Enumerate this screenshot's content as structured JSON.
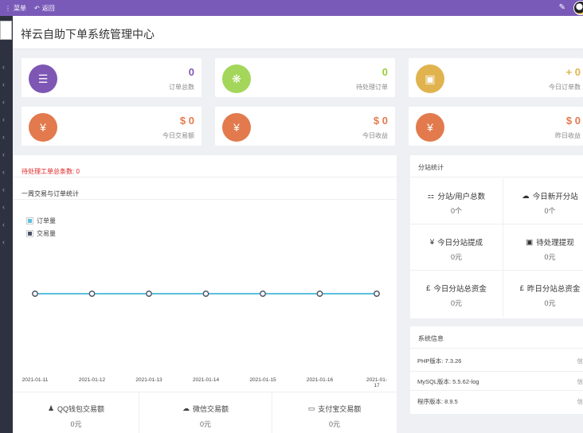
{
  "topbar": {
    "menu_label": "菜单",
    "back_label": "返回"
  },
  "page": {
    "title": "祥云自助下单系统管理中心"
  },
  "stats": [
    {
      "value": "0",
      "label": "订单总数",
      "color": "#7e57b5",
      "icon": "list-icon",
      "value_color": "#7e57b5"
    },
    {
      "value": "0",
      "label": "待处理订单",
      "color": "#a3d65a",
      "icon": "gift-icon",
      "value_color": "#9acd32"
    },
    {
      "value": "+ 0",
      "label": "今日订单数",
      "color": "#e0b34f",
      "icon": "briefcase-icon",
      "value_color": "#e0b34f"
    },
    {
      "value": "$ 0",
      "label": "今日交易额",
      "color": "#e27a4e",
      "icon": "yen-icon",
      "value_color": "#e27a4e"
    },
    {
      "value": "$ 0",
      "label": "今日收益",
      "color": "#e27a4e",
      "icon": "yen-icon",
      "value_color": "#e27a4e"
    },
    {
      "value": "$ 0",
      "label": "昨日收益",
      "color": "#e27a4e",
      "icon": "yen-icon",
      "value_color": "#e27a4e"
    }
  ],
  "pending": {
    "text": "待处理工单总条数: 0"
  },
  "chart_panel": {
    "heading": "一周交易与订单统计"
  },
  "chart_data": {
    "type": "line",
    "x": [
      "2021-01-11",
      "2021-01-12",
      "2021-01-13",
      "2021-01-14",
      "2021-01-15",
      "2021-01-16",
      "2021-01-17"
    ],
    "series": [
      {
        "name": "订单量",
        "values": [
          0,
          0,
          0,
          0,
          0,
          0,
          0
        ],
        "color": "#5bc0de"
      },
      {
        "name": "交易量",
        "values": [
          0,
          0,
          0,
          0,
          0,
          0,
          0
        ],
        "color": "#4a5366"
      }
    ],
    "legend": "top-left",
    "grid": false
  },
  "bottom_stats": [
    {
      "label": "QQ钱包交易额",
      "value": "0元",
      "icon": "qq-icon"
    },
    {
      "label": "微信交易额",
      "value": "0元",
      "icon": "wechat-icon"
    },
    {
      "label": "支付宝交易额",
      "value": "0元",
      "icon": "credit-card-icon"
    }
  ],
  "fenzhan": {
    "heading": "分站统计",
    "cells": [
      {
        "label": "分站/用户总数",
        "value": "0个",
        "icon": "sitemap-icon"
      },
      {
        "label": "今日新开分站",
        "value": "0个",
        "icon": "cloud-icon"
      },
      {
        "label": "今日分站提成",
        "value": "0元",
        "icon": "yen-icon"
      },
      {
        "label": "待处理提现",
        "value": "0元",
        "icon": "money-icon"
      },
      {
        "label": "今日分站总资金",
        "value": "0元",
        "icon": "pound-icon"
      },
      {
        "label": "昨日分站总资金",
        "value": "0元",
        "icon": "pound-icon"
      }
    ]
  },
  "sysinfo": {
    "heading": "系统信息",
    "rows": [
      {
        "label": "PHP版本: 7.3.26",
        "tag": "信"
      },
      {
        "label": "MySQL版本: 5.5.62-log",
        "tag": "信"
      },
      {
        "label": "程序版本: 8.9.5",
        "tag": "信"
      }
    ]
  }
}
